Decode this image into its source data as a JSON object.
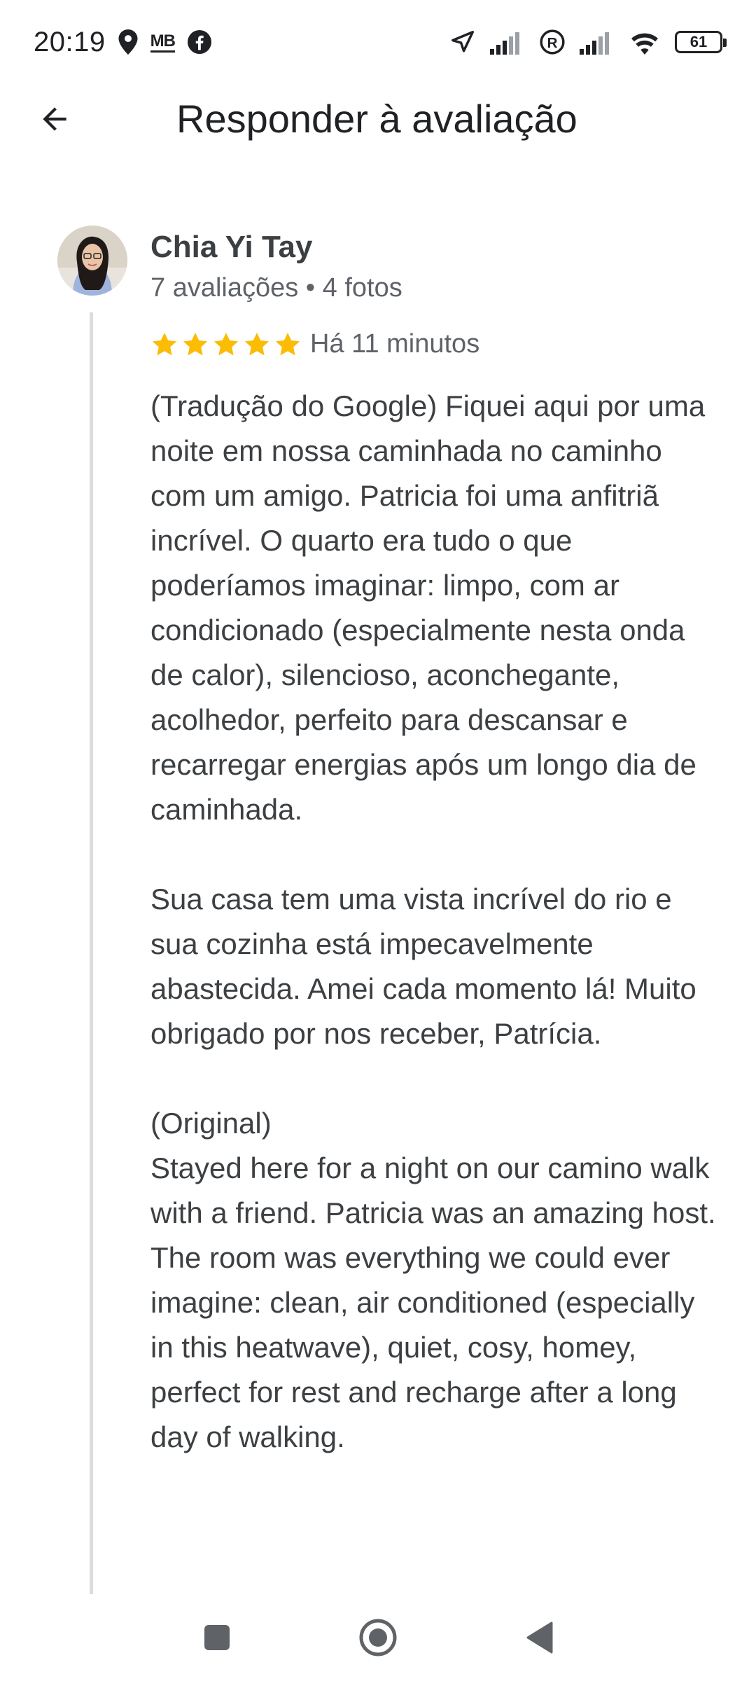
{
  "status_bar": {
    "time": "20:19",
    "mb_label": "MB",
    "battery": "61",
    "icons": [
      "location-pin-icon",
      "mb-data-icon",
      "facebook-icon",
      "navigation-arrow-icon",
      "signal-icon",
      "roaming-icon",
      "signal-icon",
      "wifi-icon",
      "battery-icon"
    ]
  },
  "app_bar": {
    "title": "Responder à avaliação",
    "back_icon": "back-arrow-icon"
  },
  "review": {
    "author": "Chia Yi Tay",
    "meta": "7 avaliações • 4 fotos",
    "rating": 5,
    "rating_max": 5,
    "time": "Há 11 minutos",
    "star_color": "#fbbc04",
    "paragraphs": [
      "(Tradução do Google) Fiquei aqui por uma noite em nossa caminhada no caminho com um amigo. Patricia foi uma anfitriã incrível. O quarto era tudo o que poderíamos imaginar: limpo, com ar condicionado (especialmente nesta onda de calor), silencioso, aconchegante, acolhedor, perfeito para descansar e recarregar energias após um longo dia de caminhada.",
      "Sua casa tem uma vista incrível do rio e sua cozinha está impecavelmente abastecida. Amei cada momento lá! Muito obrigado por nos receber, Patrícia.",
      "(Original)",
      "Stayed here for a night on our camino walk with a friend. Patricia was an amazing host. The room was everything we could ever imagine: clean, air conditioned (especially in this heatwave), quiet, cosy, homey, perfect for rest and recharge after a long day of walking."
    ]
  },
  "nav_bar": {
    "icons": [
      "recent-apps-icon",
      "home-icon",
      "back-triangle-icon"
    ]
  }
}
